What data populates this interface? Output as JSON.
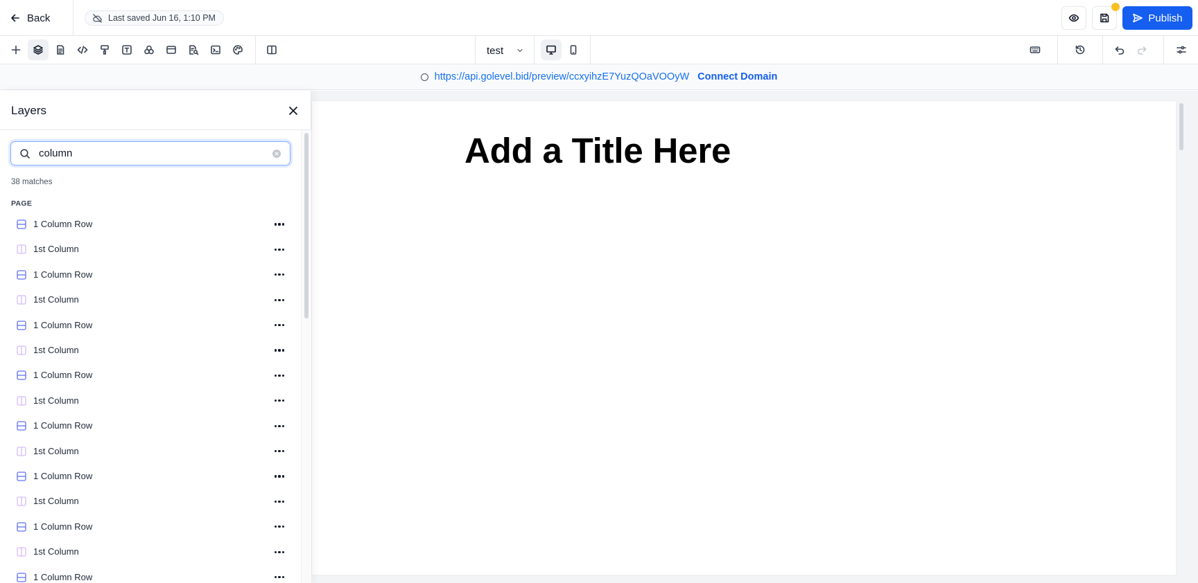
{
  "topbar": {
    "back_label": "Back",
    "save_status": "Last saved Jun 16, 1:10 PM",
    "publish_label": "Publish",
    "icons": [
      "arrow-left-icon",
      "cloud-off-icon",
      "eye-icon",
      "save-icon",
      "send-icon"
    ]
  },
  "toolbar": {
    "left_tools": [
      "add",
      "layers",
      "pages",
      "code",
      "paint",
      "text",
      "components",
      "media",
      "seo",
      "scripts",
      "theme",
      "columns"
    ],
    "active_tool": "layers",
    "page_select": "test",
    "device_modes": [
      "desktop",
      "mobile"
    ],
    "active_device": "desktop",
    "right_tools": [
      "keyboard",
      "history",
      "undo",
      "redo",
      "settings"
    ]
  },
  "urlbar": {
    "url": "https://api.golevel.bid/preview/ccxyihzE7YuzQOaVOOyW",
    "connect_label": "Connect Domain"
  },
  "layers": {
    "title": "Layers",
    "search_value": "column",
    "match_count": "38 matches",
    "section_label": "PAGE",
    "items": [
      {
        "label": "1 Column Row",
        "type": "row"
      },
      {
        "label": "1st Column",
        "type": "column"
      },
      {
        "label": "1 Column Row",
        "type": "row"
      },
      {
        "label": "1st Column",
        "type": "column"
      },
      {
        "label": "1 Column Row",
        "type": "row"
      },
      {
        "label": "1st Column",
        "type": "column"
      },
      {
        "label": "1 Column Row",
        "type": "row"
      },
      {
        "label": "1st Column",
        "type": "column"
      },
      {
        "label": "1 Column Row",
        "type": "row"
      },
      {
        "label": "1st Column",
        "type": "column"
      },
      {
        "label": "1 Column Row",
        "type": "row"
      },
      {
        "label": "1st Column",
        "type": "column"
      },
      {
        "label": "1 Column Row",
        "type": "row"
      },
      {
        "label": "1st Column",
        "type": "column"
      },
      {
        "label": "1 Column Row",
        "type": "row"
      }
    ]
  },
  "canvas": {
    "heading": "Add a Title Here"
  },
  "colors": {
    "accent": "#155eef",
    "link": "#1570ef",
    "row_icon": "#6172f3",
    "column_icon": "#d6bbfb",
    "save_dot": "#fbbf24"
  }
}
